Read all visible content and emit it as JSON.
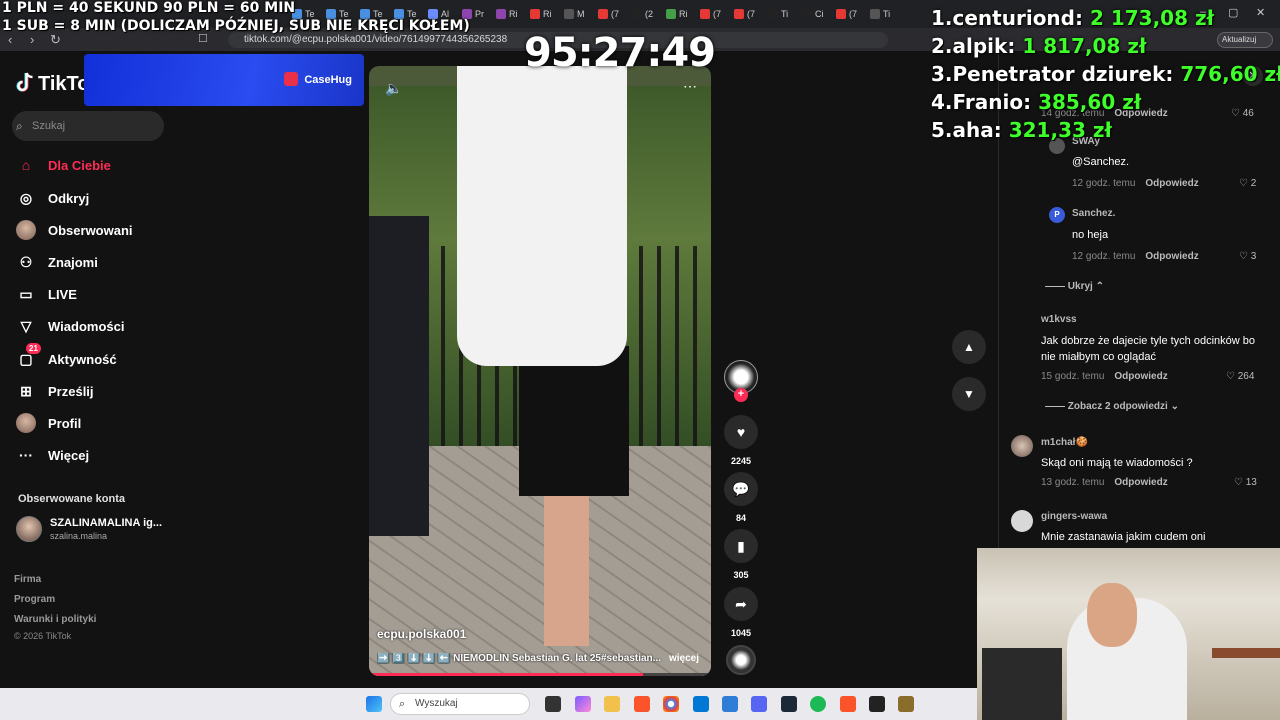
{
  "overlay": {
    "donate_line1": "1 PLN = 40 SEKUND 90 PLN = 60 MIN",
    "donate_line2": "1 SUB = 8 MIN (DOLICZAM PÓŹNIEJ, SUB NIE KRĘCI KOŁEM)",
    "timer": "95:27:49",
    "leaderboard": [
      {
        "rank": "1.",
        "name": "centuriond:",
        "amount": "2 173,08 zł"
      },
      {
        "rank": "2.",
        "name": "alpik:",
        "amount": "1 817,08 zł"
      },
      {
        "rank": "3.",
        "name": "Penetrator dziurek:",
        "amount": "776,60 zł"
      },
      {
        "rank": "4.",
        "name": "Franio:",
        "amount": "385,60 zł"
      },
      {
        "rank": "5.",
        "name": "aha:",
        "amount": "321,33 zł"
      }
    ],
    "amount_color": "#3fff2a"
  },
  "browser": {
    "url": "tiktok.com/@ecpu.polska001/video/7614997744356265238",
    "update_label": "Aktualizuj",
    "tabs": [
      {
        "label": "Te",
        "color": "#4a90e2"
      },
      {
        "label": "Te",
        "color": "#4a90e2"
      },
      {
        "label": "Te",
        "color": "#4a90e2"
      },
      {
        "label": "Te",
        "color": "#4a90e2"
      },
      {
        "label": "Al",
        "color": "#6a8cff"
      },
      {
        "label": "Pr",
        "color": "#8e44ad"
      },
      {
        "label": "Ri",
        "color": "#8e44ad"
      },
      {
        "label": "Ri",
        "color": "#e53935"
      },
      {
        "label": "M",
        "color": "#555"
      },
      {
        "label": "(7",
        "color": "#e53935"
      },
      {
        "label": "(2",
        "color": "#222"
      },
      {
        "label": "Ri",
        "color": "#43a047"
      },
      {
        "label": "(7",
        "color": "#e53935"
      },
      {
        "label": "(7",
        "color": "#e53935"
      },
      {
        "label": "Ti",
        "color": "#222"
      },
      {
        "label": "Ci",
        "color": "#222"
      },
      {
        "label": "(7",
        "color": "#e53935"
      },
      {
        "label": "Ti",
        "color": "#555"
      }
    ]
  },
  "tiktok": {
    "logo": "TikTok",
    "accent": "#fe2c55",
    "ad_label": "CaseHug",
    "search_placeholder": "Szukaj",
    "nav": [
      {
        "label": "Dla Ciebie",
        "icon": "home-icon",
        "glyph": "⌂"
      },
      {
        "label": "Odkryj",
        "icon": "compass-icon",
        "glyph": "◎"
      },
      {
        "label": "Obserwowani",
        "icon": "following-avatar-icon",
        "glyph": ""
      },
      {
        "label": "Znajomi",
        "icon": "friends-icon",
        "glyph": "⚇"
      },
      {
        "label": "LIVE",
        "icon": "live-tv-icon",
        "glyph": "▭"
      },
      {
        "label": "Wiadomości",
        "icon": "messages-icon",
        "glyph": "▽"
      },
      {
        "label": "Aktywność",
        "icon": "activity-icon",
        "glyph": "▢",
        "badge": "21"
      },
      {
        "label": "Prześlij",
        "icon": "upload-icon",
        "glyph": "⊞"
      },
      {
        "label": "Profil",
        "icon": "profile-avatar-icon",
        "glyph": ""
      },
      {
        "label": "Więcej",
        "icon": "more-dots-icon",
        "glyph": "···"
      }
    ],
    "followed_heading": "Obserwowane konta",
    "followed_account": {
      "name": "SZALINAMALINA ig...",
      "username": "szalina.malina"
    },
    "footer_links": [
      "Firma",
      "Program",
      "Warunki i polityki"
    ],
    "copyright": "© 2026 TikTok"
  },
  "video": {
    "author": "ecpu.polska001",
    "caption": "➡️ 3️⃣ ⬇️ ⬇️ ⬅️ NIEMODLIN Sebastian G. lat 25#sebastian...",
    "more_link": "więcej",
    "progress": 0.8,
    "likes": "2245",
    "comments": "84",
    "saves": "305",
    "shares": "1045"
  },
  "comments": {
    "items": [
      {
        "meta": "14 godz. temu",
        "reply": "Odpowiedz",
        "likes": "46"
      },
      {
        "user": "SWAy",
        "text": "@Sanchez.",
        "meta": "12 godz. temu",
        "reply": "Odpowiedz",
        "likes": "2"
      },
      {
        "user": "Sanchez.",
        "text": "no heja",
        "meta": "12 godz. temu",
        "reply": "Odpowiedz",
        "likes": "3",
        "avatar_letter": "P"
      },
      {
        "user": "w1kvss",
        "text": "Jak dobrze że dajecie tyle tych odcinków bo nie miałbym co oglądać",
        "meta": "15 godz. temu",
        "reply": "Odpowiedz",
        "likes": "264"
      },
      {
        "user": "m1chał🍪",
        "text": "Skąd oni mają te wiadomości ?",
        "meta": "13 godz. temu",
        "reply": "Odpowiedz",
        "likes": "13"
      },
      {
        "user": "gingers-wawa",
        "text": "Mnie zastanawia jakim cudem oni"
      }
    ],
    "hide_label": "Ukryj",
    "view_replies_label": "Zobacz 2 odpowiedzi"
  },
  "taskbar": {
    "search_placeholder": "Wyszukaj"
  }
}
